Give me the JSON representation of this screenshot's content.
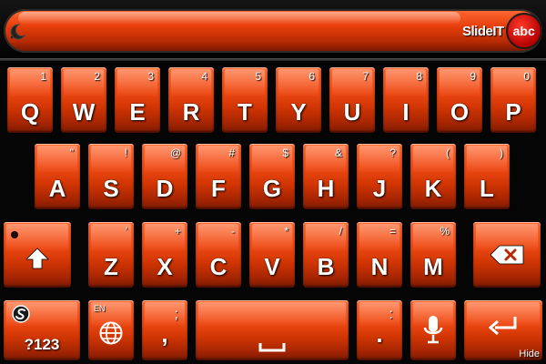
{
  "topbar": {
    "brand_name": "SlideIT",
    "brand_abc": "abc"
  },
  "rows": {
    "row1": [
      {
        "key": "Q",
        "sub": "1"
      },
      {
        "key": "W",
        "sub": "2"
      },
      {
        "key": "E",
        "sub": "3"
      },
      {
        "key": "R",
        "sub": "4"
      },
      {
        "key": "T",
        "sub": "5"
      },
      {
        "key": "Y",
        "sub": "6"
      },
      {
        "key": "U",
        "sub": "7"
      },
      {
        "key": "I",
        "sub": "8"
      },
      {
        "key": "O",
        "sub": "9"
      },
      {
        "key": "P",
        "sub": "0"
      }
    ],
    "row2": [
      {
        "key": "A",
        "sub": "\""
      },
      {
        "key": "S",
        "sub": "!"
      },
      {
        "key": "D",
        "sub": "@"
      },
      {
        "key": "F",
        "sub": "#"
      },
      {
        "key": "G",
        "sub": "$"
      },
      {
        "key": "H",
        "sub": "&"
      },
      {
        "key": "J",
        "sub": "?"
      },
      {
        "key": "K",
        "sub": "("
      },
      {
        "key": "L",
        "sub": ")"
      }
    ],
    "row3": [
      {
        "key": "Z",
        "sub": "'"
      },
      {
        "key": "X",
        "sub": "+"
      },
      {
        "key": "C",
        "sub": "-"
      },
      {
        "key": "V",
        "sub": "*"
      },
      {
        "key": "B",
        "sub": "/"
      },
      {
        "key": "N",
        "sub": "="
      },
      {
        "key": "M",
        "sub": "%"
      }
    ]
  },
  "bottom": {
    "symbols_label": "?123",
    "language_label": "EN",
    "comma_key": ",",
    "comma_sub": ";",
    "period_key": ".",
    "period_sub": ":",
    "hide_label": "Hide"
  },
  "colors": {
    "key_top": "#ff6b33",
    "key_bottom": "#7c1a00",
    "background": "#050505"
  },
  "icons": {
    "collapse": "moon-collapse-icon",
    "shift": "shift-arrow-icon",
    "backspace": "backspace-icon",
    "symbols": "slideit-logo-icon",
    "language": "globe-icon",
    "space": "space-bar-icon",
    "mic": "microphone-icon",
    "enter": "enter-return-icon"
  }
}
